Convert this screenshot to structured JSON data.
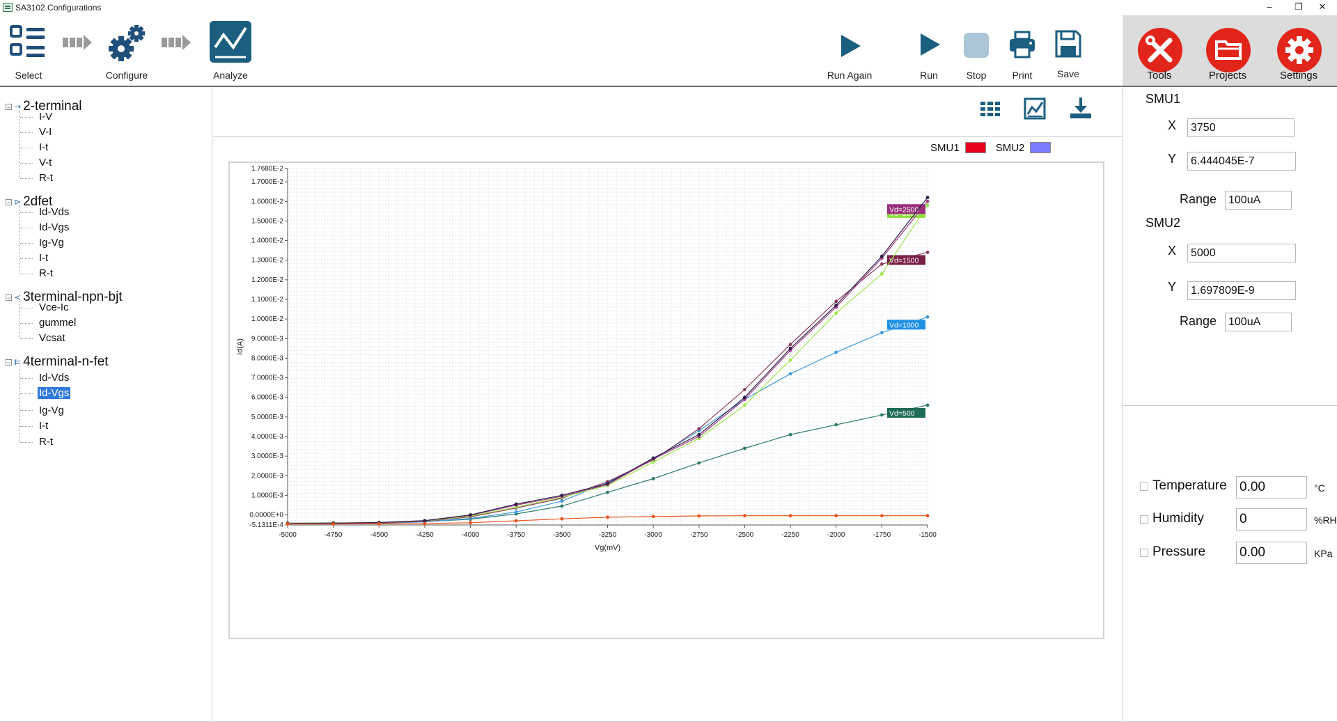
{
  "window": {
    "title": "SA3102 Configurations",
    "controls": {
      "minimize": "–",
      "maximize": "❐",
      "close": "✕"
    }
  },
  "workflow": [
    {
      "label": "Select",
      "icon": "select-list-icon"
    },
    {
      "label": "Configure",
      "icon": "configure-gears-icon"
    },
    {
      "label": "Analyze",
      "icon": "analyze-chart-icon"
    }
  ],
  "actions": {
    "run_again": "Run Again",
    "run": "Run",
    "stop": "Stop",
    "print": "Print",
    "save": "Save"
  },
  "tools": {
    "tools": "Tools",
    "projects": "Projects",
    "settings": "Settings",
    "accent": "#e1251b"
  },
  "tree": [
    {
      "label": "2-terminal",
      "children": [
        "I-V",
        "V-I",
        "I-t",
        "V-t",
        "R-t"
      ]
    },
    {
      "label": "2dfet",
      "children": [
        "Id-Vds",
        "Id-Vgs",
        "Ig-Vg",
        "I-t",
        "R-t"
      ]
    },
    {
      "label": "3terminal-npn-bjt",
      "children": [
        "Vce-Ic",
        "gummel",
        "Vcsat"
      ]
    },
    {
      "label": "4terminal-n-fet",
      "children": [
        "Id-Vds",
        "Id-Vgs",
        "Ig-Vg",
        "I-t",
        "R-t"
      ],
      "selected_child": "Id-Vgs"
    }
  ],
  "legend": {
    "smu1": "SMU1",
    "smu1_color": "#e8001c",
    "smu2": "SMU2",
    "smu2_color": "#7b7bff"
  },
  "chart_data": {
    "type": "line",
    "xlabel": "Vg(mV)",
    "ylabel": "Id(A)",
    "xlim": [
      -5000,
      -1500
    ],
    "ylim": [
      -0.00051311,
      0.01768
    ],
    "grid": true,
    "x_ticks": [
      "-5000",
      "-4750",
      "-4500",
      "-4250",
      "-4000",
      "-3750",
      "-3500",
      "-3250",
      "-3000",
      "-2750",
      "-2500",
      "-2250",
      "-2000",
      "-1750",
      "-1500"
    ],
    "y_ticks": [
      {
        "v": 0.01768,
        "t": "1.7680E-2"
      },
      {
        "v": 0.017,
        "t": "1.7000E-2"
      },
      {
        "v": 0.016,
        "t": "1.6000E-2"
      },
      {
        "v": 0.015,
        "t": "1.5000E-2"
      },
      {
        "v": 0.014,
        "t": "1.4000E-2"
      },
      {
        "v": 0.013,
        "t": "1.3000E-2"
      },
      {
        "v": 0.012,
        "t": "1.2000E-2"
      },
      {
        "v": 0.011,
        "t": "1.1000E-2"
      },
      {
        "v": 0.01,
        "t": "1.0000E-2"
      },
      {
        "v": 0.009,
        "t": "9.0000E-3"
      },
      {
        "v": 0.008,
        "t": "8.0000E-3"
      },
      {
        "v": 0.007,
        "t": "7.0000E-3"
      },
      {
        "v": 0.006,
        "t": "6.0000E-3"
      },
      {
        "v": 0.005,
        "t": "5.0000E-3"
      },
      {
        "v": 0.004,
        "t": "4.0000E-3"
      },
      {
        "v": 0.003,
        "t": "3.0000E-3"
      },
      {
        "v": 0.002,
        "t": "2.0000E-3"
      },
      {
        "v": 0.001,
        "t": "1.0000E-3"
      },
      {
        "v": 0.0,
        "t": "0.0000E+0"
      },
      {
        "v": -0.00051311,
        "t": "-5.1311E-4"
      }
    ],
    "x": [
      -5000,
      -4750,
      -4500,
      -4250,
      -4000,
      -3750,
      -3500,
      -3250,
      -3000,
      -2750,
      -2500,
      -2250,
      -2000,
      -1750,
      -1500
    ],
    "series": [
      {
        "name": "Vd=500",
        "color": "#2e7d6b",
        "label_bg": "#1f6b57",
        "values": [
          -0.00042,
          -0.00041,
          -0.0004,
          -0.00034,
          -0.00022,
          5e-05,
          0.00045,
          0.00115,
          0.00185,
          0.00265,
          0.0034,
          0.0041,
          0.0046,
          0.0051,
          0.0056
        ]
      },
      {
        "name": "Vd=1000",
        "color": "#3b9bd8",
        "label_bg": "#1e90e6",
        "values": [
          -0.00045,
          -0.00044,
          -0.00042,
          -0.00036,
          -0.00018,
          0.00015,
          0.0007,
          0.00165,
          0.00285,
          0.0043,
          0.0059,
          0.0072,
          0.0083,
          0.0093,
          0.0101
        ]
      },
      {
        "name": "Vd=1500",
        "color": "#8b3d5e",
        "label_bg": "#7a1f46",
        "values": [
          -0.00045,
          -0.00044,
          -0.00041,
          -0.00033,
          -0.0001,
          0.00035,
          0.00085,
          0.0017,
          0.0028,
          0.0044,
          0.0064,
          0.0087,
          0.0109,
          0.0128,
          0.0134
        ]
      },
      {
        "name": "Vd=2000",
        "color": "#9be84b",
        "label_bg": "#8ee03a",
        "values": [
          -0.00045,
          -0.00043,
          -0.0004,
          -0.00031,
          -6e-05,
          0.0004,
          0.0009,
          0.0015,
          0.0027,
          0.0039,
          0.0056,
          0.0079,
          0.0103,
          0.0123,
          0.0158
        ]
      },
      {
        "name": "Vd=2500",
        "color": "#a23c86",
        "label_bg": "#9b2e7a",
        "values": [
          -0.00045,
          -0.00043,
          -0.0004,
          -0.0003,
          -2e-05,
          0.0005,
          0.00095,
          0.00155,
          0.00285,
          0.004,
          0.0059,
          0.0084,
          0.0106,
          0.0131,
          0.016
        ]
      },
      {
        "name": "",
        "color": "#2b1f4a",
        "label_bg": "#2b1f4a",
        "values": [
          -0.00044,
          -0.00042,
          -0.00039,
          -0.00029,
          0.0,
          0.00055,
          0.001,
          0.0016,
          0.0029,
          0.0041,
          0.006,
          0.0085,
          0.0107,
          0.0132,
          0.0162
        ]
      },
      {
        "name": "",
        "color": "#e8541e",
        "label_bg": "#e8541e",
        "values": [
          -0.00046,
          -0.00046,
          -0.00045,
          -0.00044,
          -0.0004,
          -0.0003,
          -0.0002,
          -0.00012,
          -8e-05,
          -5e-05,
          -4e-05,
          -4e-05,
          -4e-05,
          -4e-05,
          -4e-05
        ]
      }
    ]
  },
  "smu1": {
    "heading": "SMU1",
    "x_label": "X",
    "x_value": "3750",
    "y_label": "Y",
    "y_value": "6.444045E-7",
    "range_label": "Range",
    "range_value": "100uA"
  },
  "smu2": {
    "heading": "SMU2",
    "x_label": "X",
    "x_value": "5000",
    "y_label": "Y",
    "y_value": "1.697809E-9",
    "range_label": "Range",
    "range_value": "100uA"
  },
  "environment": [
    {
      "label": "Temperature",
      "value": "0.00",
      "unit": "°C"
    },
    {
      "label": "Humidity",
      "value": "0",
      "unit": "%RH"
    },
    {
      "label": "Pressure",
      "value": "0.00",
      "unit": "KPa"
    }
  ]
}
